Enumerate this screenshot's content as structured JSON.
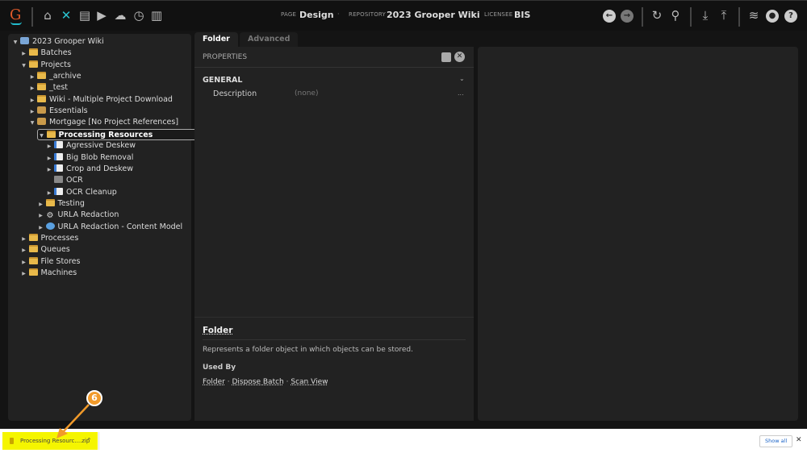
{
  "header": {
    "logo": "G",
    "nav_icons": [
      "home-icon",
      "design-tools-icon",
      "batches-icon",
      "tasks-icon",
      "cloud-upload-icon",
      "jobs-icon",
      "stats-icon"
    ],
    "page_label": "PAGE",
    "page_value": "Design",
    "repo_label": "REPOSITORY",
    "repo_value": "2023 Grooper Wiki",
    "licensee_label": "LICENSEE",
    "licensee_value": "BIS",
    "right_icons": [
      "back-icon",
      "forward-icon",
      "refresh-icon",
      "search-icon",
      "download-icon",
      "upload-icon",
      "database-icon",
      "user-icon",
      "help-icon"
    ]
  },
  "tree": [
    {
      "label": "2023 Grooper Wiki",
      "level": 0,
      "arrow": "down",
      "icon": "root"
    },
    {
      "label": "Batches",
      "level": 1,
      "arrow": "right",
      "icon": "folder"
    },
    {
      "label": "Projects",
      "level": 1,
      "arrow": "down",
      "icon": "folder"
    },
    {
      "label": "_archive",
      "level": 2,
      "arrow": "right",
      "icon": "folder"
    },
    {
      "label": "_test",
      "level": 2,
      "arrow": "right",
      "icon": "folder"
    },
    {
      "label": "Wiki - Multiple Project Download",
      "level": 2,
      "arrow": "right",
      "icon": "folder"
    },
    {
      "label": "Essentials",
      "level": 2,
      "arrow": "right",
      "icon": "project"
    },
    {
      "label": "Mortgage [No Project References]",
      "level": 2,
      "arrow": "down",
      "icon": "project"
    },
    {
      "label": "Processing Resources",
      "level": 3,
      "arrow": "down",
      "icon": "folder",
      "selected": true
    },
    {
      "label": "Agressive Deskew",
      "level": 4,
      "arrow": "right",
      "icon": "ipp"
    },
    {
      "label": "Big Blob Removal",
      "level": 4,
      "arrow": "right",
      "icon": "ipp"
    },
    {
      "label": "Crop and Deskew",
      "level": 4,
      "arrow": "right",
      "icon": "ipp"
    },
    {
      "label": "OCR",
      "level": 4,
      "arrow": "",
      "icon": "ocr"
    },
    {
      "label": "OCR Cleanup",
      "level": 4,
      "arrow": "right",
      "icon": "ipp"
    },
    {
      "label": "Testing",
      "level": 3,
      "arrow": "right",
      "icon": "folder"
    },
    {
      "label": "URLA Redaction",
      "level": 3,
      "arrow": "right",
      "icon": "batchproc"
    },
    {
      "label": "URLA Redaction - Content Model",
      "level": 3,
      "arrow": "right",
      "icon": "cm"
    },
    {
      "label": "Processes",
      "level": 1,
      "arrow": "right",
      "icon": "folder"
    },
    {
      "label": "Queues",
      "level": 1,
      "arrow": "right",
      "icon": "folder"
    },
    {
      "label": "File Stores",
      "level": 1,
      "arrow": "right",
      "icon": "folder"
    },
    {
      "label": "Machines",
      "level": 1,
      "arrow": "right",
      "icon": "folder"
    }
  ],
  "tabs": [
    {
      "label": "Folder",
      "active": true
    },
    {
      "label": "Advanced",
      "active": false
    }
  ],
  "properties": {
    "title": "PROPERTIES",
    "section": "GENERAL",
    "rows": [
      {
        "name": "Description",
        "value": "(none)",
        "ellipsis": "..."
      }
    ]
  },
  "help": {
    "title": "Folder",
    "description": "Represents a folder object in which objects can be stored.",
    "used_by_label": "Used By",
    "used_by": [
      "Folder",
      "Dispose Batch",
      "Scan View"
    ],
    "sep": "·"
  },
  "downloads": {
    "file": "Processing Resourc....zip",
    "show_all": "Show all",
    "close": "✕"
  },
  "callout": "6",
  "colors": {
    "accent_cyan": "#2bc4d0",
    "highlight": "#f5f500",
    "callout": "#f19a2a"
  }
}
